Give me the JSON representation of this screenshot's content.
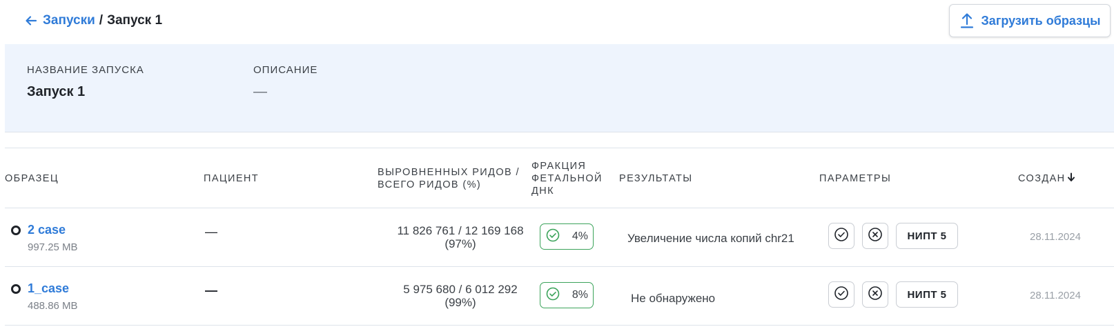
{
  "breadcrumb": {
    "back_icon": "arrow-left-icon",
    "parent": "Запуски",
    "separator": "/",
    "current": "Запуск 1"
  },
  "upload_button": {
    "label": "Загрузить образцы",
    "icon": "upload-icon"
  },
  "run_info": {
    "name_label": "НАЗВАНИЕ ЗАПУСКА",
    "name_value": "Запуск 1",
    "description_label": "ОПИСАНИЕ",
    "description_value": "—"
  },
  "table": {
    "headers": {
      "sample": "ОБРАЗЕЦ",
      "patient": "ПАЦИЕНТ",
      "reads_line1": "ВЫРОВНЕННЫХ РИДОВ /",
      "reads_line2": "ВСЕГО РИДОВ (%)",
      "fraction_line1": "ФРАКЦИЯ",
      "fraction_line2": "ФЕТАЛЬНОЙ",
      "fraction_line3": "ДНК",
      "results": "РЕЗУЛЬТАТЫ",
      "params": "ПАРАМЕТРЫ",
      "created": "СОЗДАН",
      "sort_icon": "arrow-down-icon"
    },
    "rows": [
      {
        "name": "2 case",
        "size": "997.25 MB",
        "patient": "—",
        "reads_line1": "11 826 761 / 12 169 168",
        "reads_line2": "(97%)",
        "fraction": "4%",
        "result": "Увеличение числа копий chr21",
        "param_label": "НИПТ 5",
        "created": "28.11.2024"
      },
      {
        "name": "1_case",
        "size": "488.86 MB",
        "patient": "—",
        "reads_line1": "5 975 680 / 6 012 292",
        "reads_line2": "(99%)",
        "fraction": "8%",
        "result": "Не обнаружено",
        "param_label": "НИПТ 5",
        "created": "28.11.2024"
      }
    ]
  },
  "colors": {
    "accent": "#2f7bd8",
    "success": "#3ba35a",
    "panel_bg": "#eef4fd"
  }
}
